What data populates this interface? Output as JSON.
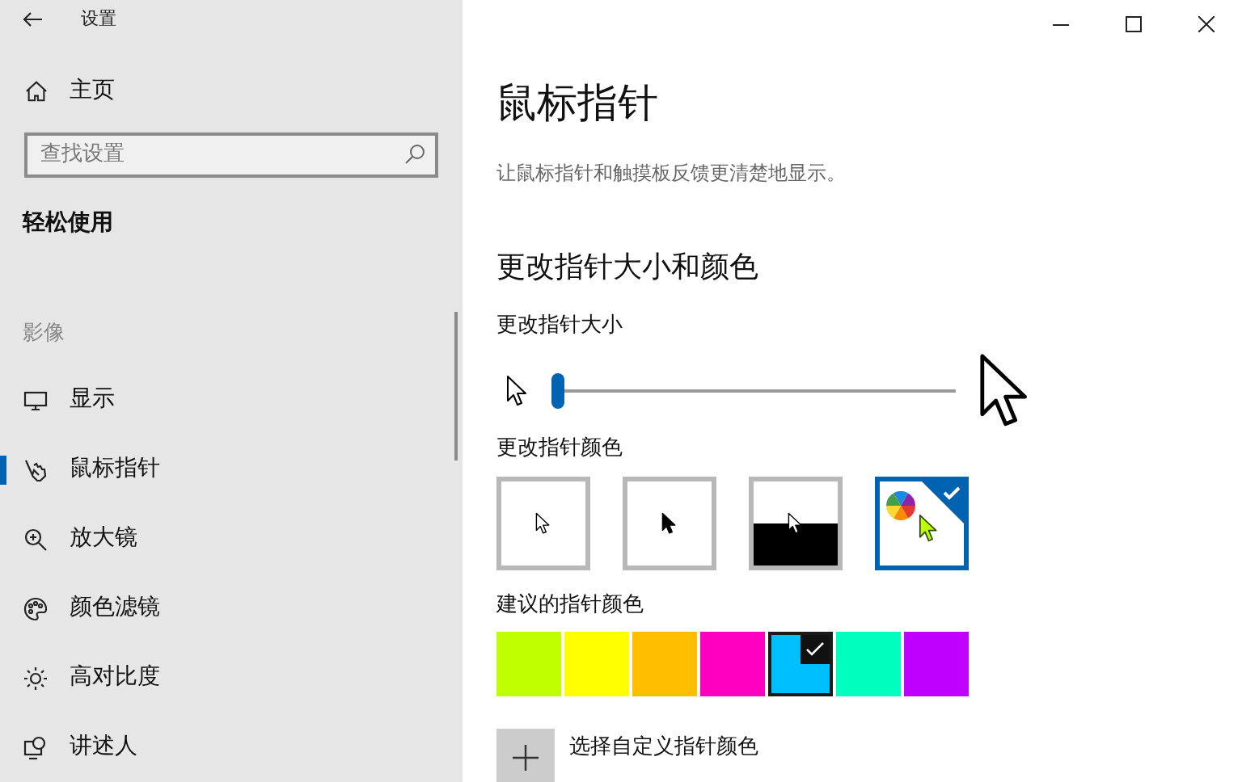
{
  "window": {
    "title": "设置"
  },
  "sidebar": {
    "home": "主页",
    "search": {
      "placeholder": "查找设置"
    },
    "category": "轻松使用",
    "section": "影像",
    "items": [
      {
        "label": "显示",
        "kind": "display",
        "selected": false
      },
      {
        "label": "鼠标指针",
        "kind": "pointer",
        "selected": true
      },
      {
        "label": "放大镜",
        "kind": "magnifier",
        "selected": false
      },
      {
        "label": "颜色滤镜",
        "kind": "palette",
        "selected": false
      },
      {
        "label": "高对比度",
        "kind": "contrast",
        "selected": false
      },
      {
        "label": "讲述人",
        "kind": "narrator",
        "selected": false
      }
    ]
  },
  "page": {
    "title": "鼠标指针",
    "description": "让鼠标指针和触摸板反馈更清楚地显示。",
    "section": "更改指针大小和颜色",
    "size": {
      "label": "更改指针大小",
      "level": 0
    },
    "pointer_color": {
      "label": "更改指针颜色",
      "options": [
        {
          "kind": "white",
          "selected": false
        },
        {
          "kind": "black",
          "selected": false
        },
        {
          "kind": "inverted",
          "selected": false
        },
        {
          "kind": "custom",
          "selected": true
        }
      ]
    },
    "suggested": {
      "label": "建议的指针颜色",
      "swatches": [
        {
          "color": "#bfff00",
          "selected": false
        },
        {
          "color": "#ffff00",
          "selected": false
        },
        {
          "color": "#ffbf00",
          "selected": false
        },
        {
          "color": "#ff00bf",
          "selected": false
        },
        {
          "color": "#00bfff",
          "selected": true
        },
        {
          "color": "#00ffbf",
          "selected": false
        },
        {
          "color": "#bf00ff",
          "selected": false
        }
      ]
    },
    "custom_button": "选择自定义指针颜色"
  }
}
